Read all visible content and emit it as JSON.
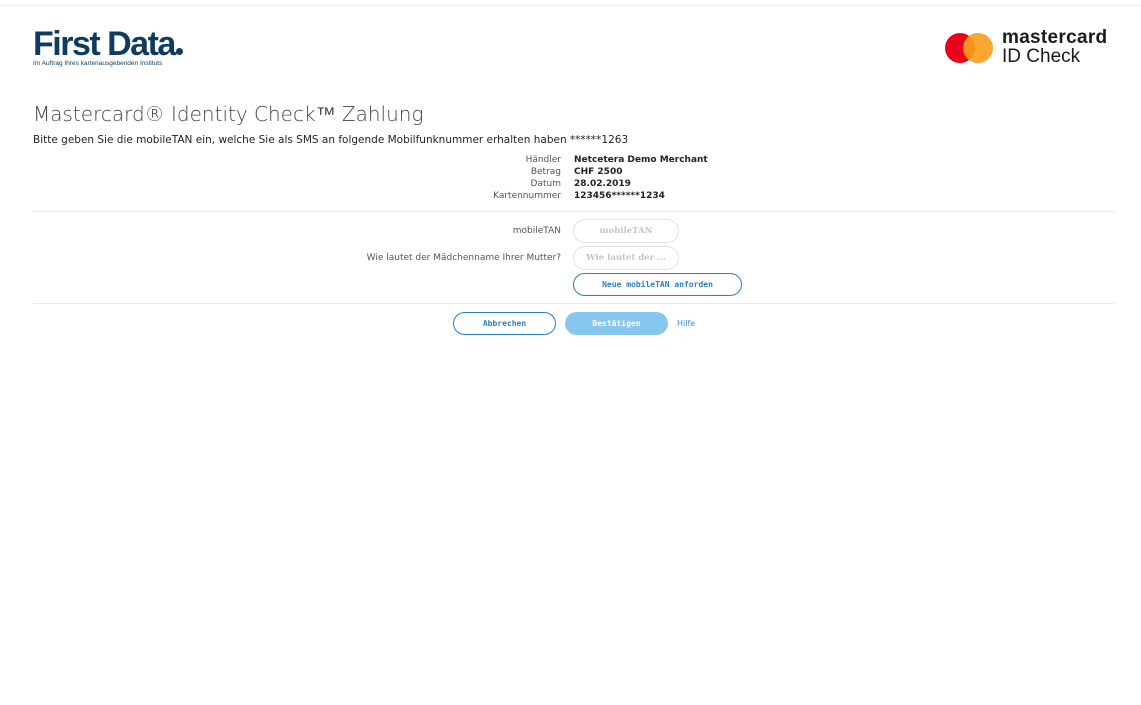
{
  "header": {
    "issuer_logo_text": "First Data",
    "issuer_subtitle": "Im Auftrag Ihres kartenausgebenden Instituts",
    "scheme_logo_word": "mastercard",
    "scheme_logo_product": "ID Check",
    "scheme_colors": {
      "red": "#eb001b",
      "yellow": "#f79e1b"
    }
  },
  "title": "Mastercard® Identity Check™ Zahlung",
  "instruction": "Bitte geben Sie die mobileTAN ein, welche Sie als SMS an folgende Mobilfunknummer erhalten haben ******1263",
  "details": [
    {
      "label": "Händler",
      "value": "Netcetera Demo Merchant"
    },
    {
      "label": "Betrag",
      "value": "CHF 2500"
    },
    {
      "label": "Datum",
      "value": "28.02.2019"
    },
    {
      "label": "Kartennummer",
      "value": "123456******1234"
    }
  ],
  "form": {
    "tan_label": "mobileTAN",
    "tan_placeholder": "mobileTAN",
    "tan_value": "",
    "question_label": "Wie lautet der Mädchenname Ihrer Mutter?",
    "question_placeholder": "Wie lautet der ...",
    "question_value": "",
    "resend_label": "Neue mobileTAN anforden"
  },
  "actions": {
    "cancel_label": "Abbrechen",
    "confirm_label": "Bestätigen",
    "help_label": "Hilfe"
  },
  "colors": {
    "brand_dark": "#0f3c5e",
    "accent_blue": "#2a7fc2",
    "primary_disabled": "#87c6ee"
  }
}
